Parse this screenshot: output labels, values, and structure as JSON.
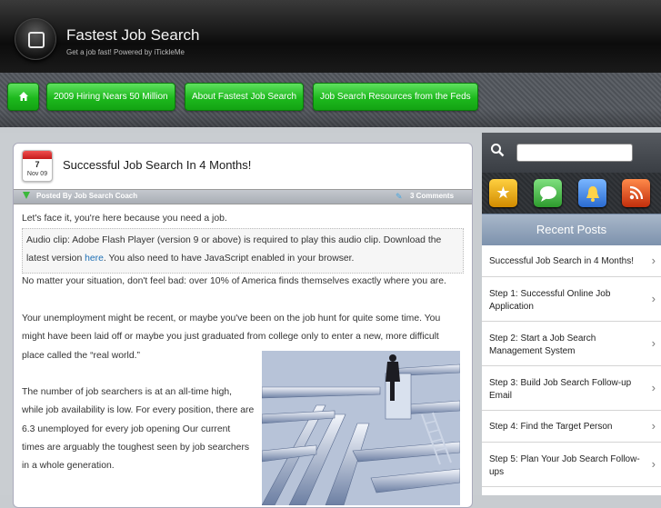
{
  "header": {
    "title": "Fastest Job Search",
    "tagline": "Get a job fast! Powered by iTickleMe"
  },
  "nav": {
    "home_icon": "home-icon",
    "items": [
      {
        "label": "2009 Hiring Nears 50 Million"
      },
      {
        "label": "About Fastest Job Search"
      },
      {
        "label": "Job Search Resources from the Feds"
      }
    ]
  },
  "post": {
    "date_day": "7",
    "date_month": "Nov 09",
    "title": "Successful Job Search In 4 Months!",
    "posted_by": "Posted By Job Search Coach",
    "comments": "3 Comments",
    "intro": "Let's face it, you're here because you need a job.",
    "audio_line1": "Audio clip: Adobe Flash Player (version 9 or above) is required to play this audio clip. Download the",
    "audio_line2_pre": "latest version ",
    "audio_link": "here",
    "audio_line2_post": ". You also need to have JavaScript enabled in your browser.",
    "para1": "No matter your situation, don't feel bad: over 10% of America finds themselves exactly where you are.",
    "para2_lines": [
      "Your unemployment might be recent, or maybe you've been on the job hunt for quite some time. You",
      "might have been laid off or maybe you just graduated from college only to enter a new, more difficult",
      "place called the “real world.”"
    ],
    "para3_lines": [
      "The number of job searchers is at an all-time high,",
      "while job availability is low. For every position, there are",
      "6.3 unemployed for every job opening Our current",
      "times are arguably the toughest seen by job searchers",
      "in a whole generation."
    ]
  },
  "sidebar": {
    "search_placeholder": "",
    "icons": [
      "star-icon",
      "chat-icon",
      "bell-icon",
      "rss-icon"
    ],
    "recent_title": "Recent Posts",
    "recent_posts": [
      {
        "label": "Successful Job Search in 4 Months!"
      },
      {
        "label": "Step 1: Successful Online Job Application"
      },
      {
        "label": "Step 2: Start a Job Search Management System"
      },
      {
        "label": "Step 3: Build Job Search Follow-up Email"
      },
      {
        "label": "Step 4: Find the Target Person"
      },
      {
        "label": "Step 5: Plan Your Job Search Follow-ups"
      }
    ]
  },
  "colors": {
    "nav_green": "#1db91d",
    "link_blue": "#1e6fb4",
    "calendar_red": "#c51b1b"
  }
}
